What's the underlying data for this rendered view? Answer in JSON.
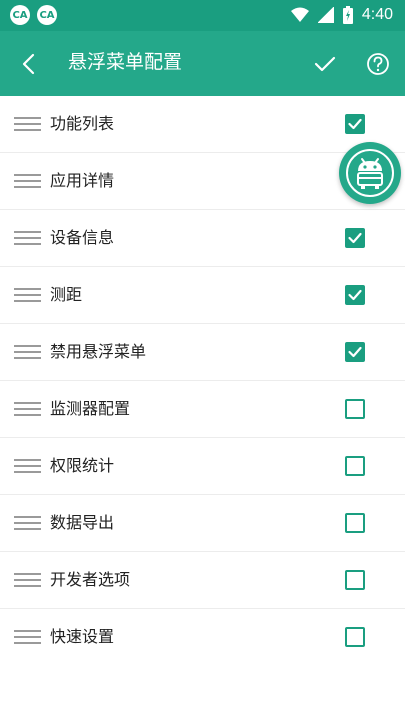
{
  "status_bar": {
    "app_icon_1": "CA",
    "app_icon_2": "CA",
    "time": "4:40",
    "icons": [
      "wifi-icon",
      "signal-icon",
      "battery-icon"
    ]
  },
  "appbar": {
    "title": "悬浮菜单配置",
    "color": "#24a88a",
    "icons": [
      "back-arrow-icon",
      "check-icon",
      "help-icon"
    ]
  },
  "items": [
    {
      "label": "功能列表",
      "checked": true
    },
    {
      "label": "应用详情",
      "checked": true
    },
    {
      "label": "设备信息",
      "checked": true
    },
    {
      "label": "测距",
      "checked": true
    },
    {
      "label": "禁用悬浮菜单",
      "checked": true
    },
    {
      "label": "监测器配置",
      "checked": false
    },
    {
      "label": "权限统计",
      "checked": false
    },
    {
      "label": "数据导出",
      "checked": false
    },
    {
      "label": "开发者选项",
      "checked": false
    },
    {
      "label": "快速设置",
      "checked": false
    }
  ],
  "floating_button": {
    "icon": "android-icon"
  },
  "colors": {
    "accent": "#1a9e80",
    "divider": "#ececec"
  }
}
